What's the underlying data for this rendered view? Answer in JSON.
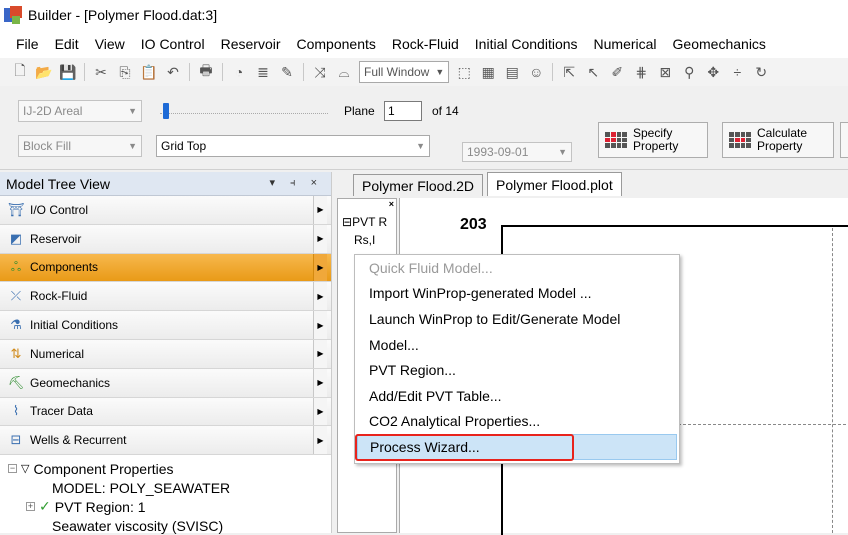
{
  "window": {
    "title": "Builder - [Polymer Flood.dat:3]"
  },
  "menu": [
    "File",
    "Edit",
    "View",
    "IO Control",
    "Reservoir",
    "Components",
    "Rock-Fluid",
    "Initial Conditions",
    "Numerical",
    "Geomechanics"
  ],
  "toolbar1": {
    "view_combo": "Full Window"
  },
  "toolbar2": {
    "view_type": "IJ-2D Areal",
    "fill_type": "Block Fill",
    "property": "Grid Top",
    "date": "1993-09-01",
    "plane_label": "Plane",
    "plane_value": "1",
    "of_label": "of 14",
    "specify_line1": "Specify",
    "specify_line2": "Property",
    "calculate_line1": "Calculate",
    "calculate_line2": "Property"
  },
  "model_tree": {
    "title": "Model Tree View",
    "controls": "▾ ⫞ ×",
    "sections": [
      {
        "label": "I/O Control",
        "icon": "io-icon"
      },
      {
        "label": "Reservoir",
        "icon": "reservoir-icon"
      },
      {
        "label": "Components",
        "icon": "components-icon",
        "selected": true
      },
      {
        "label": "Rock-Fluid",
        "icon": "rockfluid-icon"
      },
      {
        "label": "Initial Conditions",
        "icon": "initial-icon"
      },
      {
        "label": "Numerical",
        "icon": "numerical-icon"
      },
      {
        "label": "Geomechanics",
        "icon": "geomech-icon"
      },
      {
        "label": "Tracer Data",
        "icon": "tracer-icon"
      },
      {
        "label": "Wells & Recurrent",
        "icon": "wells-icon"
      }
    ],
    "tree": {
      "root": "Component Properties",
      "model": "MODEL: POLY_SEAWATER",
      "pvt": "PVT Region: 1",
      "visc": "Seawater viscosity (SVISC)"
    }
  },
  "tabs": [
    {
      "label": "Polymer Flood.2D"
    },
    {
      "label": "Polymer Flood.plot",
      "active": true
    }
  ],
  "subpanel": {
    "row1": "PVT R",
    "row2": "Rs,I"
  },
  "plot": {
    "ytick": "203"
  },
  "context_menu": [
    {
      "label": "Quick Fluid Model...",
      "disabled": true
    },
    {
      "label": "Import WinProp-generated Model ..."
    },
    {
      "label": "Launch WinProp to Edit/Generate Model"
    },
    {
      "label": "Model..."
    },
    {
      "label": "PVT Region..."
    },
    {
      "label": "Add/Edit PVT Table..."
    },
    {
      "label": "CO2 Analytical Properties..."
    },
    {
      "label": "Process Wizard...",
      "hover": true
    }
  ],
  "colors": {
    "selected": "#f0a53a",
    "highlight_border": "#e8231c",
    "hover": "#cce4f7"
  }
}
